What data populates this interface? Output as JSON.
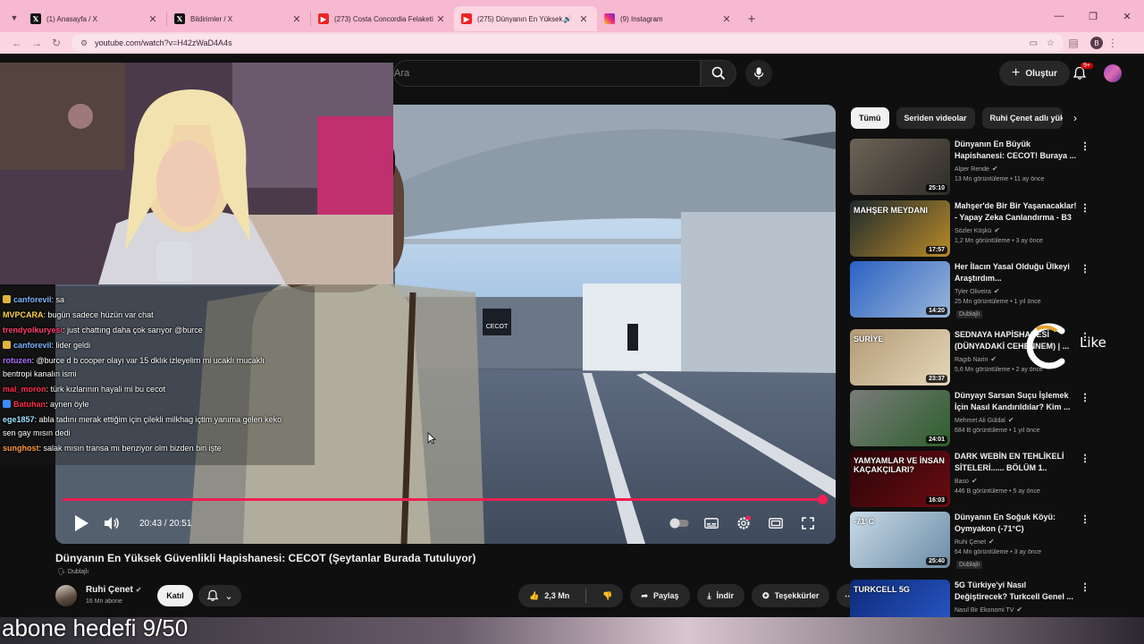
{
  "browser": {
    "tabs": [
      {
        "title": "(1) Anasayfa / X",
        "icon": "x-logo"
      },
      {
        "title": "Bildirimler / X",
        "icon": "x-logo"
      },
      {
        "title": "(273) Costa Concordia Felaketi",
        "icon": "youtube-logo"
      },
      {
        "title": "(275) Dünyanın En Yüksek",
        "icon": "youtube-logo"
      },
      {
        "title": "(9) Instagram",
        "icon": "instagram-logo"
      }
    ],
    "new_tab": "+",
    "url": "youtube.com/watch?v=H42zWaD4A4s",
    "profile_letter": "B"
  },
  "header": {
    "search_placeholder": "Ara",
    "create_label": "Oluştur",
    "notification_count": "9+"
  },
  "player": {
    "time": "20:43 / 20:51",
    "progress_fraction": 0.992,
    "scene_text": "CECOT"
  },
  "chat": [
    {
      "user": "canforevil",
      "text": ": sa",
      "color": "#7db4ff",
      "sub": true
    },
    {
      "user": "MVPCARA",
      "text": ": bugün sadece hüzün var chat",
      "color": "#ffd24a",
      "sub": false
    },
    {
      "user": "trendyolkuryesi",
      "text": ": just chattıng daha çok sarıyor @burce",
      "color": "#ff3b6b",
      "sub": false
    },
    {
      "user": "canforevil",
      "text": ": lider geldi",
      "color": "#7db4ff",
      "sub": true
    },
    {
      "user": "rotuzen",
      "text": ": @burce d b cooper olayı var 15 dklık izleyelim mi ucaklı mucaklı",
      "color": "#b06cff",
      "sub": false
    },
    {
      "user": "",
      "text": "bentropi kanalın ismi",
      "color": "#ffffff",
      "sub": false
    },
    {
      "user": "mal_moron",
      "text": ": türk kızlarının hayali mi bu cecot",
      "color": "#ff2a4a",
      "sub": false
    },
    {
      "user": "Batuhan",
      "text": ": aynen öyle",
      "color": "#ff2a4a",
      "sub": true
    },
    {
      "user": "ege1857",
      "text": ": abla tadını merak ettiğim için çilekli milkhag içtim yanıma gelen keko",
      "color": "#9be3ff",
      "sub": false
    },
    {
      "user": "",
      "text": "sen gay mısın dedi",
      "color": "#ffffff",
      "sub": false
    },
    {
      "user": "sunghost",
      "text": ": salak mısın transa mı benziyor olm bizden biri işte",
      "color": "#ff9a3c",
      "sub": false
    }
  ],
  "video": {
    "title": "Dünyanın En Yüksek Güvenlikli Hapishanesi: CECOT (Şeytanlar Burada Tutuluyor)",
    "dubbed_label": "Dublajlı",
    "channel": "Ruhi Çenet",
    "subscribers": "16 Mn abone",
    "join_label": "Katıl",
    "likes": "2,3 Mn",
    "share_label": "Paylaş",
    "download_label": "İndir",
    "thanks_label": "Teşekkürler"
  },
  "chips": [
    "Tümü",
    "Seriden videolar",
    "Ruhi Çenet adlı yükleyici"
  ],
  "recommendations": [
    {
      "title": "Dünyanın En Büyük Hapishanesi: CECOT! Buraya ...",
      "channel": "Alper Rende",
      "meta": "13 Mn görüntüleme • 11 ay önce",
      "duration": "25:10",
      "badge": "",
      "colors": [
        "#6d6457",
        "#2e2b27"
      ]
    },
    {
      "title": "Mahşer'de Bir Bir Yaşanacaklar! - Yapay Zeka Canlandırma - B3",
      "channel": "Sözler Köşkü",
      "meta": "1,2 Mn görüntüleme • 3 ay önce",
      "duration": "17:57",
      "badge": "",
      "colors": [
        "#1f2a2c",
        "#b88a2a"
      ],
      "thumb_text": "MAHŞER MEYDANI"
    },
    {
      "title": "Her İlacın Yasal Olduğu Ülkeyi Araştırdım...",
      "channel": "Tyler Oliveira",
      "meta": "25 Mn görüntüleme • 1 yıl önce",
      "duration": "14:20",
      "badge": "Dublajlı",
      "colors": [
        "#2b62c4",
        "#9ab6d8"
      ]
    },
    {
      "title": "SEDNAYA HAPİSHANESİ (DÜNYADAKİ CEHENNEM) | ...",
      "channel": "Ragıb Narin",
      "meta": "5,6 Mn görüntüleme • 2 ay önce",
      "duration": "23:37",
      "badge": "",
      "colors": [
        "#b39a76",
        "#e5d7b9"
      ],
      "thumb_text": "SURİYE"
    },
    {
      "title": "Dünyayı Sarsan Suçu İşlemek İçin Nasıl Kandırıldılar? Kim ...",
      "channel": "Mehmet Ali Güldal",
      "meta": "684 B görüntüleme • 1 yıl önce",
      "duration": "24:01",
      "badge": "",
      "colors": [
        "#7a7c7a",
        "#2d5f2c"
      ]
    },
    {
      "title": "DARK WEBİN EN TEHLİKELİ SİTELERİ...... BÖLÜM 1..",
      "channel": "Baso",
      "meta": "446 B görüntüleme • 5 ay önce",
      "duration": "16:03",
      "badge": "",
      "colors": [
        "#2a0508",
        "#6a0c12"
      ],
      "thumb_text": "YAMYAMLAR VE İNSAN KAÇAKÇILARI?"
    },
    {
      "title": "Dünyanın En Soğuk Köyü: Oymyakon (-71°C)",
      "channel": "Ruhi Çenet",
      "meta": "64 Mn görüntüleme • 3 ay önce",
      "duration": "25:40",
      "badge": "Dublajlı",
      "colors": [
        "#c9dbe8",
        "#6b8ba5"
      ],
      "thumb_text": "-71°C"
    },
    {
      "title": "5G Türkiye'yi Nasıl Değiştirecek? Turkcell Genel ...",
      "channel": "Nasıl Bir Ekonomi TV",
      "meta": "",
      "duration": "",
      "badge": "",
      "colors": [
        "#0d2a78",
        "#2a59c9"
      ],
      "thumb_text": "TURKCELL 5G"
    }
  ],
  "overlay": {
    "like_text": "Like",
    "subscriber_goal": "abone hedefi 9/50"
  },
  "colors": {
    "accent": "#ff0033",
    "tabbar": "#f7b9d0"
  }
}
